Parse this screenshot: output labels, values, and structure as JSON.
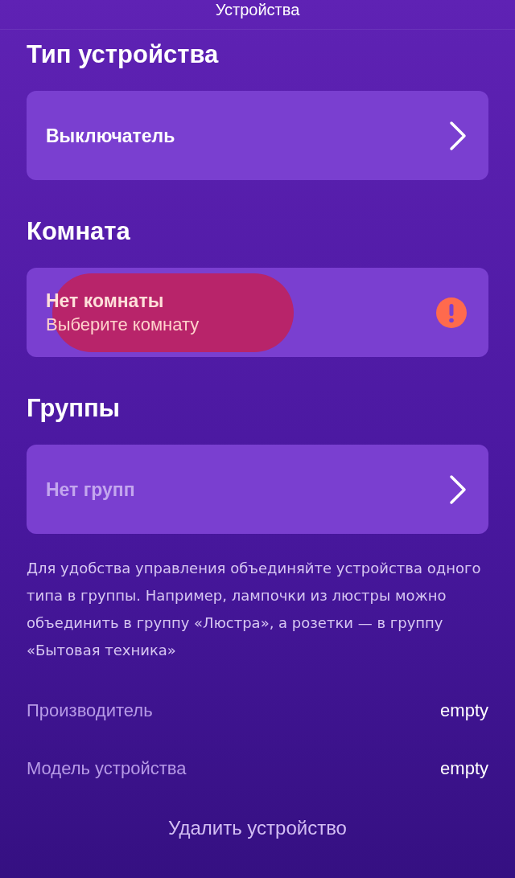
{
  "header": {
    "title": "Устройства"
  },
  "sections": [
    {
      "title": "Тип устройства",
      "card": {
        "kind": "value",
        "label": "Выключатель"
      }
    },
    {
      "title": "Комната",
      "card": {
        "kind": "warning",
        "label": "Нет комнаты",
        "hint": "Выберите комнату",
        "highlighted": true
      }
    },
    {
      "title": "Группы",
      "card": {
        "kind": "empty",
        "label": "Нет групп"
      }
    }
  ],
  "note": "Для удобства управления объединяйте устройства одного типа в группы. Например, лампочки из люстры можно объединить в группу «Люстра», а розетки — в группу «Бытовая техника»",
  "details": [
    {
      "label": "Производитель",
      "value": "empty"
    },
    {
      "label": "Модель устройства",
      "value": "empty"
    }
  ],
  "delete_button": "Удалить устройство"
}
